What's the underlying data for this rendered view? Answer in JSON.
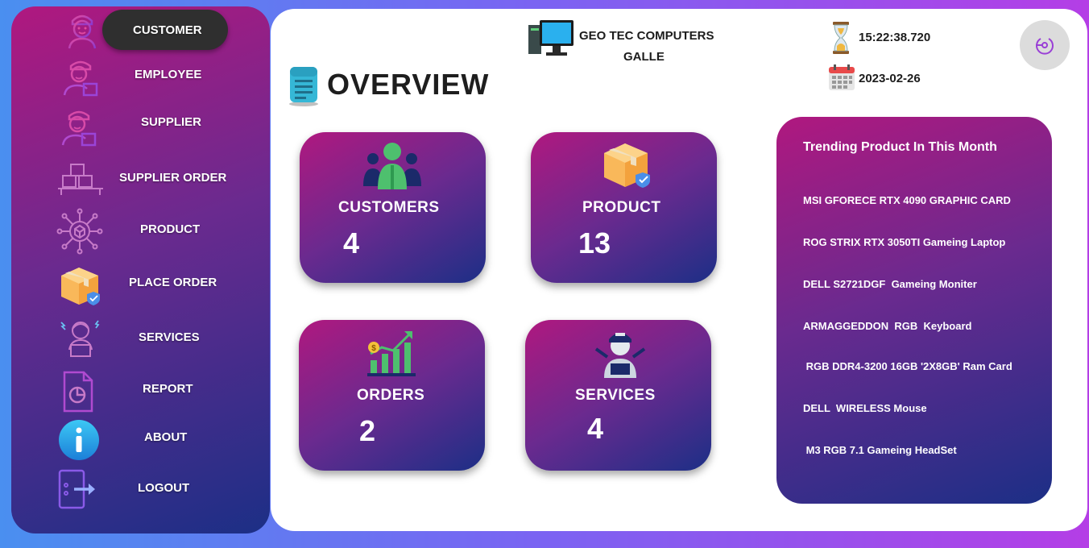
{
  "sidebar": {
    "items": [
      {
        "label": "CUSTOMER",
        "icon": "customer-icon"
      },
      {
        "label": "EMPLOYEE",
        "icon": "employee-icon"
      },
      {
        "label": "SUPPLIER",
        "icon": "supplier-icon"
      },
      {
        "label": "SUPPLIER ORDER",
        "icon": "supplier-order-icon"
      },
      {
        "label": "PRODUCT",
        "icon": "product-network-icon"
      },
      {
        "label": "PLACE ORDER",
        "icon": "package-icon"
      },
      {
        "label": "SERVICES",
        "icon": "technician-icon"
      },
      {
        "label": "REPORT",
        "icon": "report-icon"
      },
      {
        "label": "ABOUT",
        "icon": "info-icon"
      },
      {
        "label": "LOGOUT",
        "icon": "logout-icon"
      }
    ],
    "active": "CUSTOMER"
  },
  "header": {
    "brand_name": "GEO TEC COMPUTERS",
    "brand_city": "GALLE",
    "time": "15:22:38.720",
    "date": "2023-02-26"
  },
  "overview": {
    "title": "OVERVIEW",
    "cards": [
      {
        "label": "CUSTOMERS",
        "value": "4",
        "icon": "people-icon"
      },
      {
        "label": "PRODUCT",
        "value": "13",
        "icon": "package-icon"
      },
      {
        "label": "ORDERS",
        "value": "2",
        "icon": "growth-chart-icon"
      },
      {
        "label": "SERVICES",
        "value": "4",
        "icon": "technician-icon"
      }
    ]
  },
  "trending": {
    "title": "Trending Product In This Month",
    "items": [
      "MSI GFORECE RTX 4090 GRAPHIC CARD",
      "ROG STRIX RTX 3050TI Gameing Laptop",
      "DELL S2721DGF  Gameing Moniter",
      "ARMAGGEDDON  RGB  Keyboard",
      " RGB DDR4-3200 16GB '2X8GB' Ram Card",
      "DELL  WIRELESS Mouse",
      " M3 RGB 7.1 Gameing HeadSet"
    ]
  },
  "colors": {
    "gradient_start": "#b0187f",
    "gradient_end": "#1c2f86",
    "active_pill": "#2f2f2f"
  }
}
